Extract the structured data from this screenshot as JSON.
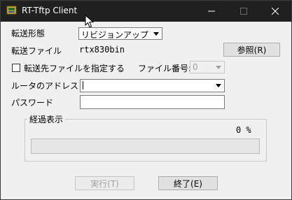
{
  "window": {
    "title": "RT-Tftp Client"
  },
  "form": {
    "transfer_mode_label": "転送形態",
    "transfer_mode_value": "リビジョンアップ",
    "transfer_file_label": "転送ファイル",
    "transfer_file_value": "rtx830bin",
    "browse_button": "参照(R)",
    "dest_checkbox_label": "転送先ファイルを指定する",
    "dest_checkbox_checked": false,
    "file_number_label": "ファイル番号:",
    "file_number_value": "0",
    "router_address_label": "ルータのアドレス",
    "router_address_value": "",
    "password_label": "パスワード",
    "password_value": ""
  },
  "progress": {
    "group_label": "経過表示",
    "percent_text": "0 %",
    "percent": 0
  },
  "buttons": {
    "run": "実行(T)",
    "exit": "終了(E)"
  },
  "icons": {
    "app": "app-icon",
    "minimize": "minimize-icon",
    "maximize": "maximize-icon",
    "close": "close-icon",
    "dropdown": "chevron-down-icon",
    "cursor": "mouse-cursor-icon"
  }
}
